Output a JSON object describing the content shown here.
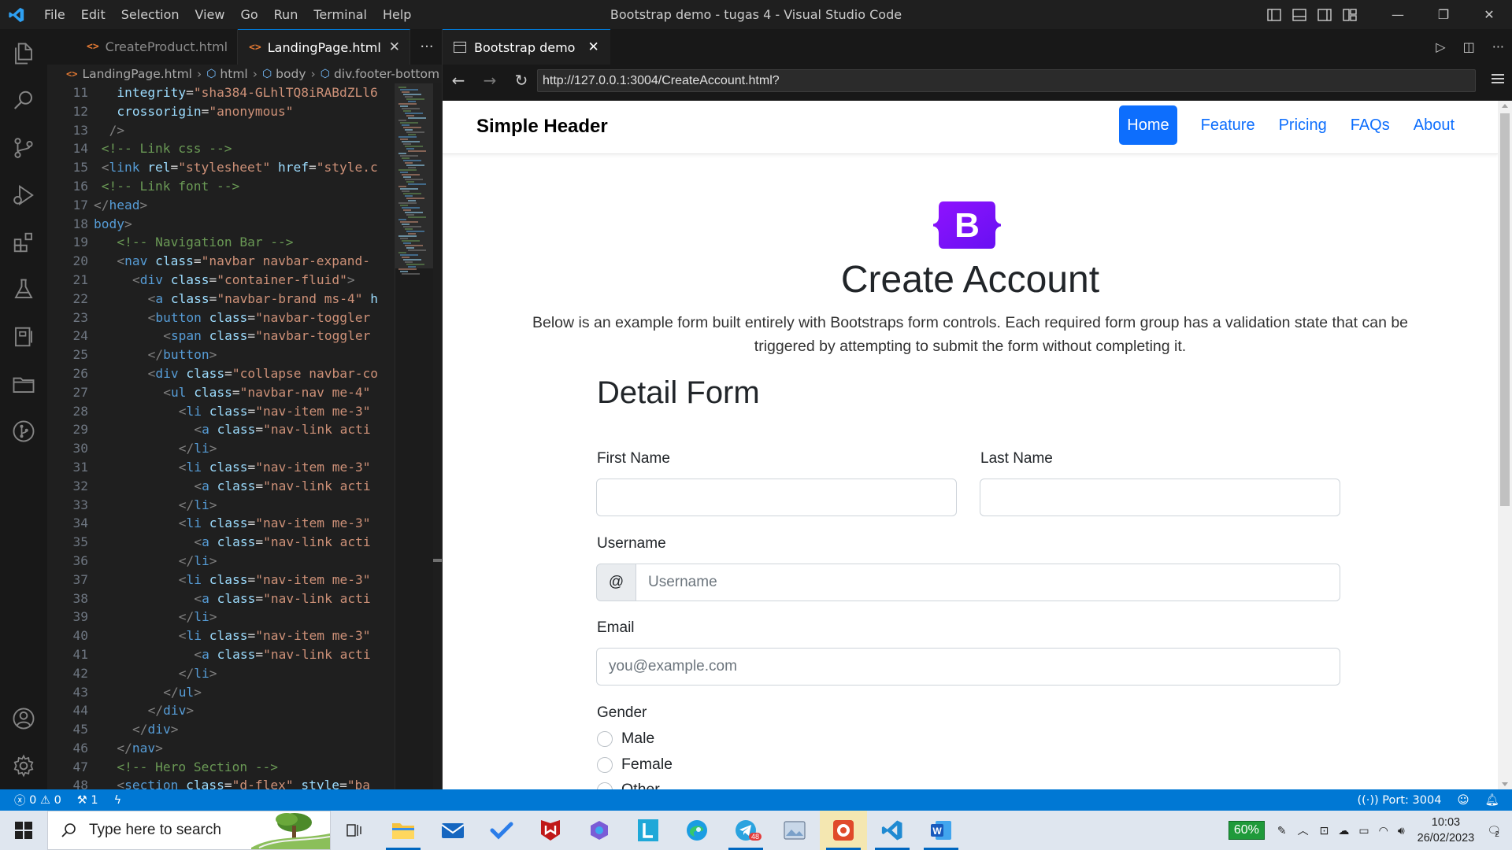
{
  "window": {
    "title": "Bootstrap demo - tugas 4 - Visual Studio Code",
    "menu": [
      "File",
      "Edit",
      "Selection",
      "View",
      "Go",
      "Run",
      "Terminal",
      "Help"
    ]
  },
  "editor": {
    "tabs": [
      {
        "icon": "<>",
        "label": "CreateProduct.html"
      },
      {
        "icon": "<>",
        "label": "LandingPage.html"
      }
    ],
    "breadcrumbs": [
      "LandingPage.html",
      "html",
      "body",
      "div.footer-bottom"
    ],
    "lines": [
      {
        "n": "11",
        "html": "<span class=\"t-attr\">integrity</span><span class=\"t-txt\">=</span><span class=\"t-str\">\"sha384-GLhlTQ8iRABdZLl6</span>"
      },
      {
        "n": "12",
        "html": "<span class=\"t-attr\">crossorigin</span><span class=\"t-txt\">=</span><span class=\"t-str\">\"anonymous\"</span>"
      },
      {
        "n": "13",
        "html": "<span class=\"t-br\">/></span>"
      },
      {
        "n": "14",
        "html": "<span class=\"t-com\">&lt;!-- Link css --&gt;</span>"
      },
      {
        "n": "15",
        "html": "<span class=\"t-br\">&lt;</span><span class=\"t-tag\">link</span> <span class=\"t-attr\">rel</span><span class=\"t-txt\">=</span><span class=\"t-str\">\"stylesheet\"</span> <span class=\"t-attr\">href</span><span class=\"t-txt\">=</span><span class=\"t-str\">\"style.c</span>"
      },
      {
        "n": "16",
        "html": "<span class=\"t-com\">&lt;!-- Link font --&gt;</span>"
      },
      {
        "n": "17",
        "html": "<span class=\"t-br\">&lt;/</span><span class=\"t-tag\">head</span><span class=\"t-br\">&gt;</span>"
      },
      {
        "n": "18",
        "html": "<span class=\"t-tag\">body</span><span class=\"t-br\">&gt;</span>"
      },
      {
        "n": "19",
        "html": "<span class=\"t-com\">&lt;!-- Navigation Bar --&gt;</span>"
      },
      {
        "n": "20",
        "html": "<span class=\"t-br\">&lt;</span><span class=\"t-tag\">nav</span> <span class=\"t-attr\">class</span><span class=\"t-txt\">=</span><span class=\"t-str\">\"navbar navbar-expand-</span>"
      },
      {
        "n": "21",
        "html": "<span class=\"t-br\">&lt;</span><span class=\"t-tag\">div</span> <span class=\"t-attr\">class</span><span class=\"t-txt\">=</span><span class=\"t-str\">\"container-fluid\"</span><span class=\"t-br\">&gt;</span>"
      },
      {
        "n": "22",
        "html": "<span class=\"t-br\">&lt;</span><span class=\"t-tag\">a</span> <span class=\"t-attr\">class</span><span class=\"t-txt\">=</span><span class=\"t-str\">\"navbar-brand ms-4\"</span> <span class=\"t-attr\">h</span>"
      },
      {
        "n": "23",
        "html": "<span class=\"t-br\">&lt;</span><span class=\"t-tag\">button</span> <span class=\"t-attr\">class</span><span class=\"t-txt\">=</span><span class=\"t-str\">\"navbar-toggler</span>"
      },
      {
        "n": "24",
        "html": "<span class=\"t-br\">&lt;</span><span class=\"t-tag\">span</span> <span class=\"t-attr\">class</span><span class=\"t-txt\">=</span><span class=\"t-str\">\"navbar-toggler</span>"
      },
      {
        "n": "25",
        "html": "<span class=\"t-br\">&lt;/</span><span class=\"t-tag\">button</span><span class=\"t-br\">&gt;</span>"
      },
      {
        "n": "26",
        "html": "<span class=\"t-br\">&lt;</span><span class=\"t-tag\">div</span> <span class=\"t-attr\">class</span><span class=\"t-txt\">=</span><span class=\"t-str\">\"collapse navbar-co</span>"
      },
      {
        "n": "27",
        "html": "<span class=\"t-br\">&lt;</span><span class=\"t-tag\">ul</span> <span class=\"t-attr\">class</span><span class=\"t-txt\">=</span><span class=\"t-str\">\"navbar-nav me-4\"</span>"
      },
      {
        "n": "28",
        "html": "<span class=\"t-br\">&lt;</span><span class=\"t-tag\">li</span> <span class=\"t-attr\">class</span><span class=\"t-txt\">=</span><span class=\"t-str\">\"nav-item me-3\"</span>"
      },
      {
        "n": "29",
        "html": "<span class=\"t-br\">&lt;</span><span class=\"t-tag\">a</span> <span class=\"t-attr\">class</span><span class=\"t-txt\">=</span><span class=\"t-str\">\"nav-link acti</span>"
      },
      {
        "n": "30",
        "html": "<span class=\"t-br\">&lt;/</span><span class=\"t-tag\">li</span><span class=\"t-br\">&gt;</span>"
      },
      {
        "n": "31",
        "html": "<span class=\"t-br\">&lt;</span><span class=\"t-tag\">li</span> <span class=\"t-attr\">class</span><span class=\"t-txt\">=</span><span class=\"t-str\">\"nav-item me-3\"</span>"
      },
      {
        "n": "32",
        "html": "<span class=\"t-br\">&lt;</span><span class=\"t-tag\">a</span> <span class=\"t-attr\">class</span><span class=\"t-txt\">=</span><span class=\"t-str\">\"nav-link acti</span>"
      },
      {
        "n": "33",
        "html": "<span class=\"t-br\">&lt;/</span><span class=\"t-tag\">li</span><span class=\"t-br\">&gt;</span>"
      },
      {
        "n": "34",
        "html": "<span class=\"t-br\">&lt;</span><span class=\"t-tag\">li</span> <span class=\"t-attr\">class</span><span class=\"t-txt\">=</span><span class=\"t-str\">\"nav-item me-3\"</span>"
      },
      {
        "n": "35",
        "html": "<span class=\"t-br\">&lt;</span><span class=\"t-tag\">a</span> <span class=\"t-attr\">class</span><span class=\"t-txt\">=</span><span class=\"t-str\">\"nav-link acti</span>"
      },
      {
        "n": "36",
        "html": "<span class=\"t-br\">&lt;/</span><span class=\"t-tag\">li</span><span class=\"t-br\">&gt;</span>"
      },
      {
        "n": "37",
        "html": "<span class=\"t-br\">&lt;</span><span class=\"t-tag\">li</span> <span class=\"t-attr\">class</span><span class=\"t-txt\">=</span><span class=\"t-str\">\"nav-item me-3\"</span>"
      },
      {
        "n": "38",
        "html": "<span class=\"t-br\">&lt;</span><span class=\"t-tag\">a</span> <span class=\"t-attr\">class</span><span class=\"t-txt\">=</span><span class=\"t-str\">\"nav-link acti</span>"
      },
      {
        "n": "39",
        "html": "<span class=\"t-br\">&lt;/</span><span class=\"t-tag\">li</span><span class=\"t-br\">&gt;</span>"
      },
      {
        "n": "40",
        "html": "<span class=\"t-br\">&lt;</span><span class=\"t-tag\">li</span> <span class=\"t-attr\">class</span><span class=\"t-txt\">=</span><span class=\"t-str\">\"nav-item me-3\"</span>"
      },
      {
        "n": "41",
        "html": "<span class=\"t-br\">&lt;</span><span class=\"t-tag\">a</span> <span class=\"t-attr\">class</span><span class=\"t-txt\">=</span><span class=\"t-str\">\"nav-link acti</span>"
      },
      {
        "n": "42",
        "html": "<span class=\"t-br\">&lt;/</span><span class=\"t-tag\">li</span><span class=\"t-br\">&gt;</span>"
      },
      {
        "n": "43",
        "html": "<span class=\"t-br\">&lt;/</span><span class=\"t-tag\">ul</span><span class=\"t-br\">&gt;</span>"
      },
      {
        "n": "44",
        "html": "<span class=\"t-br\">&lt;/</span><span class=\"t-tag\">div</span><span class=\"t-br\">&gt;</span>"
      },
      {
        "n": "45",
        "html": "<span class=\"t-br\">&lt;/</span><span class=\"t-tag\">div</span><span class=\"t-br\">&gt;</span>"
      },
      {
        "n": "46",
        "html": "<span class=\"t-br\">&lt;/</span><span class=\"t-tag\">nav</span><span class=\"t-br\">&gt;</span>"
      },
      {
        "n": "47",
        "html": "<span class=\"t-com\">&lt;!-- Hero Section --&gt;</span>"
      },
      {
        "n": "48",
        "html": "<span class=\"t-br\">&lt;</span><span class=\"t-tag\">section</span> <span class=\"t-attr\">class</span><span class=\"t-txt\">=</span><span class=\"t-str\">\"d-flex\"</span> <span class=\"t-attr\">style</span><span class=\"t-txt\">=</span><span class=\"t-str\">\"ba</span>"
      }
    ]
  },
  "browser": {
    "tab_label": "Bootstrap demo",
    "url": "http://127.0.0.1:3004/CreateAccount.html?"
  },
  "site": {
    "brand": "Simple Header",
    "nav": [
      "Home",
      "Feature",
      "Pricing",
      "FAQs",
      "About"
    ],
    "logo_letter": "B",
    "heading": "Create Account",
    "lead": "Below is an example form built entirely with Bootstraps form controls. Each required form group has a validation state that can be triggered by attempting to submit the form without completing it.",
    "form_title": "Detail Form",
    "first_name_label": "First Name",
    "last_name_label": "Last Name",
    "username_label": "Username",
    "username_prefix": "@",
    "username_placeholder": "Username",
    "email_label": "Email",
    "email_placeholder": "you@example.com",
    "gender_label": "Gender",
    "gender_options": [
      "Male",
      "Female",
      "Other"
    ]
  },
  "statusbar": {
    "errors": "0",
    "warnings": "0",
    "ports_count": "1",
    "port": "Port: 3004"
  },
  "taskbar": {
    "search_placeholder": "Type here to search",
    "battery": "60%",
    "time": "10:03",
    "date": "26/02/2023",
    "telegram_badge": "48",
    "notifications": "2"
  },
  "colors": {
    "accent": "#0078d4",
    "bootstrap_primary": "#0d6efd",
    "bootstrap_purple": "#7952b3"
  }
}
